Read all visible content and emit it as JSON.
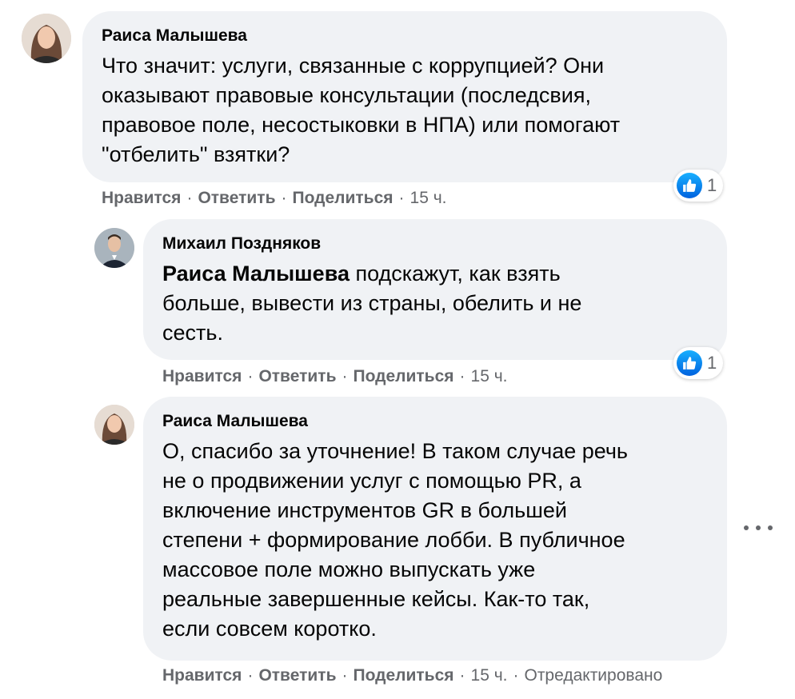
{
  "comments": [
    {
      "author": "Раиса Малышева",
      "lines": [
        "Что значит: услуги, связанные с коррупцией? Они",
        "оказывают правовые консультации (последсвия,",
        "правовое поле, несостыковки в НПА) или помогают",
        "\"отбелить\" взятки?"
      ],
      "actions": {
        "like": "Нравится",
        "reply": "Ответить",
        "share": "Поделиться",
        "time": "15 ч."
      },
      "reaction_count": "1"
    },
    {
      "author": "Михаил Поздняков",
      "mention": "Раиса Малышева",
      "lines": [
        " подскажут, как взять",
        "больше, вывести из страны, обелить и не",
        "сесть."
      ],
      "actions": {
        "like": "Нравится",
        "reply": "Ответить",
        "share": "Поделиться",
        "time": "15 ч."
      },
      "reaction_count": "1"
    },
    {
      "author": "Раиса Малышева",
      "lines": [
        "О, спасибо за уточнение! В таком случае речь",
        "не о продвижении услуг с помощью PR, а",
        "включение инструментов GR в большей",
        "степени + формирование лобби. В публичное",
        "массовое поле можно выпускать уже",
        "реальные завершенные кейсы. Как-то так,",
        "если совсем коротко."
      ],
      "actions": {
        "like": "Нравится",
        "reply": "Ответить",
        "share": "Поделиться",
        "time": "15 ч.",
        "edited": "Отредактировано"
      }
    }
  ],
  "separator": "·",
  "icons": {
    "reaction": "like-icon",
    "more": "more-options-icon"
  },
  "colors": {
    "bubble": "#f0f2f5",
    "meta": "#65676b",
    "like_blue": "#0a7cff"
  }
}
